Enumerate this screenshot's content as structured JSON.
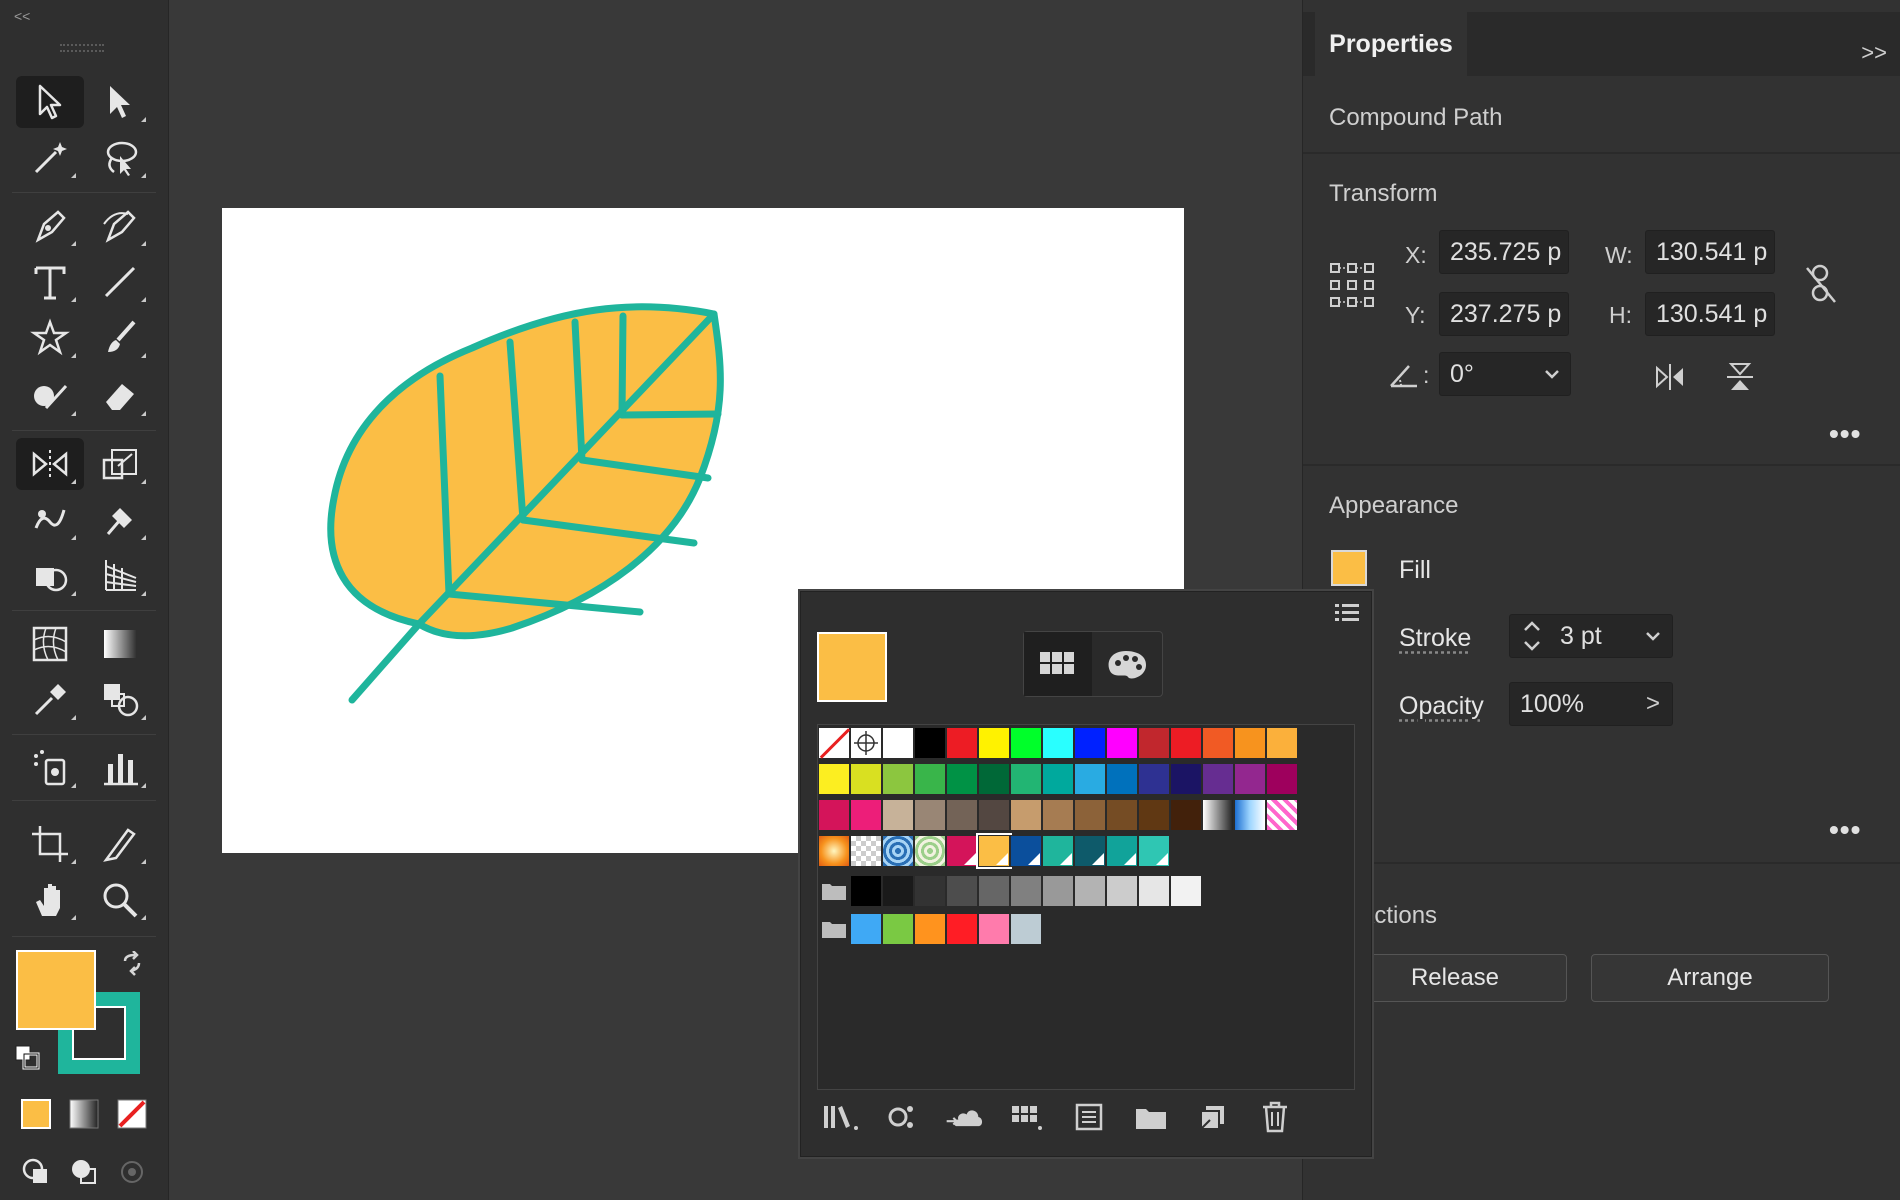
{
  "toolbar": {
    "collapse_glyph": "<<",
    "tools": [
      {
        "name": "selection-tool-icon"
      },
      {
        "name": "direct-selection-tool-icon"
      },
      {
        "name": "magic-wand-tool-icon"
      },
      {
        "name": "lasso-tool-icon"
      },
      {
        "name": "pen-tool-icon"
      },
      {
        "name": "curvature-tool-icon"
      },
      {
        "name": "type-tool-icon"
      },
      {
        "name": "line-segment-tool-icon"
      },
      {
        "name": "star-tool-icon"
      },
      {
        "name": "paintbrush-tool-icon"
      },
      {
        "name": "shaper-tool-icon"
      },
      {
        "name": "eraser-tool-icon"
      },
      {
        "name": "reflect-tool-icon"
      },
      {
        "name": "scale-tool-icon"
      },
      {
        "name": "warp-tool-icon"
      },
      {
        "name": "puppet-warp-tool-icon"
      },
      {
        "name": "shape-builder-tool-icon"
      },
      {
        "name": "perspective-grid-tool-icon"
      },
      {
        "name": "mesh-tool-icon"
      },
      {
        "name": "gradient-tool-icon"
      },
      {
        "name": "eyedropper-tool-icon"
      },
      {
        "name": "blend-tool-icon"
      },
      {
        "name": "symbol-sprayer-tool-icon"
      },
      {
        "name": "column-graph-tool-icon"
      },
      {
        "name": "artboard-tool-icon"
      },
      {
        "name": "slice-tool-icon"
      },
      {
        "name": "hand-tool-icon"
      },
      {
        "name": "zoom-tool-icon"
      }
    ],
    "fill_color": "#fbbe45",
    "stroke_color": "#1fb59c"
  },
  "canvas": {
    "leaf_fill": "#fbbe45",
    "leaf_stroke": "#1fb59c"
  },
  "properties": {
    "tab_label": "Properties",
    "expand_glyph": ">>",
    "object_type": "Compound Path",
    "transform": {
      "title": "Transform",
      "x_label": "X:",
      "x_value": "235.725 p",
      "y_label": "Y:",
      "y_value": "237.275 p",
      "w_label": "W:",
      "w_value": "130.541 p",
      "h_label": "H:",
      "h_value": "130.541 p",
      "angle_label": ":",
      "angle_value": "0°"
    },
    "appearance": {
      "title": "Appearance",
      "fill_label": "Fill",
      "stroke_label": "Stroke",
      "stroke_value": "3 pt",
      "opacity_label": "Opacity",
      "opacity_value": "100%",
      "opacity_arrow": ">"
    },
    "quick_actions": {
      "title": "ck Actions",
      "release_label": "Release",
      "arrange_label": "Arrange"
    },
    "more_glyph": "•••"
  },
  "swatches": {
    "current_color": "#fbbe45",
    "rows": [
      [
        "none",
        "registration",
        "#ffffff",
        "#000000",
        "#ed1c24",
        "#fff200",
        "#00ff2a",
        "#29ffff",
        "#0021ff",
        "#ff00ff",
        "#c1272d",
        "#ed1c24",
        "#f15a24",
        "#f7931e",
        "#fbb03b"
      ],
      [
        "#fcee21",
        "#d9e021",
        "#8cc63f",
        "#39b54a",
        "#009245",
        "#006837",
        "#22b573",
        "#00a99d",
        "#29abe2",
        "#0071bc",
        "#2e3192",
        "#1b1464",
        "#662d91",
        "#93278f",
        "#9e005d"
      ],
      [
        "#d4145a",
        "#ed1e79",
        "#c7b299",
        "#998675",
        "#736357",
        "#534741",
        "#c69c6d",
        "#a67c52",
        "#8c6239",
        "#754c24",
        "#603813",
        "#42210b",
        "gradient-bw",
        "gradient-blue",
        "pattern-pink"
      ],
      [
        "gradient-orange",
        "pattern-check",
        "pattern-blue",
        "pattern-green",
        "#d4145a",
        "#fbbe45",
        "#0b4f9c",
        "#1fb59c",
        "#0e5a6a",
        "#11a39a",
        "#2fc6b3"
      ],
      [
        "folder",
        "#000000",
        "#1a1a1a",
        "#333333",
        "#4d4d4d",
        "#666666",
        "#808080",
        "#999999",
        "#b3b3b3",
        "#cccccc",
        "#e6e6e6",
        "#f2f2f2"
      ],
      [
        "folder",
        "#3fa9f5",
        "#7ac943",
        "#ff931e",
        "#ff1d25",
        "#ff7bac",
        "#bdccd4"
      ]
    ]
  }
}
